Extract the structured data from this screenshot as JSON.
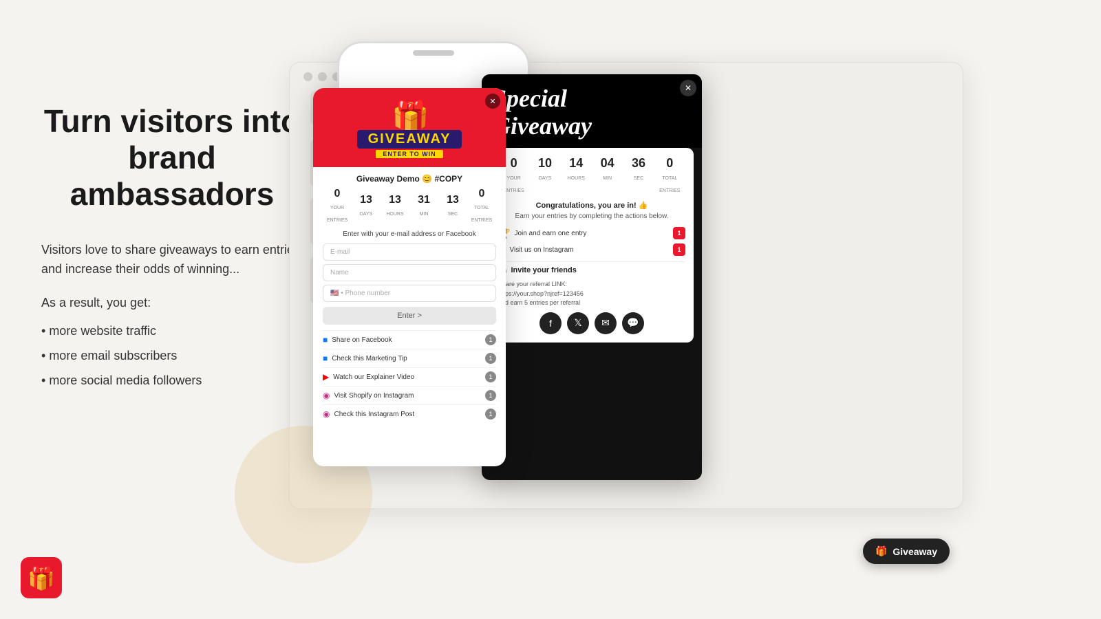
{
  "page": {
    "background_color": "#f5f3ef"
  },
  "left": {
    "heading": "Turn visitors into brand ambassadors",
    "sub_text": "Visitors love to share giveaways to earn entries and increase their odds of winning...",
    "result_heading": "As a result, you get:",
    "bullets": [
      "more website traffic",
      "more email subscribers",
      "more social media followers"
    ]
  },
  "browser": {
    "dots": [
      "#d0cec8",
      "#d0cec8",
      "#d0cec8"
    ]
  },
  "giveaway_popup": {
    "close_label": "✕",
    "banner_text": "GIVEAWAY",
    "enter_to_win": "ENTER TO WIN",
    "title": "Giveaway Demo 😊 #COPY",
    "countdown": {
      "your_entries": {
        "value": "0",
        "label": "Your entries"
      },
      "days": {
        "value": "13",
        "label": "DAYS"
      },
      "hours": {
        "value": "13",
        "label": "HOURS"
      },
      "min": {
        "value": "31",
        "label": "MIN"
      },
      "sec": {
        "value": "13",
        "label": "SEC"
      },
      "total_entries": {
        "value": "0",
        "label": "Total entries"
      }
    },
    "enter_text": "Enter with your e-mail address or Facebook",
    "email_placeholder": "E-mail",
    "name_placeholder": "Name",
    "phone_placeholder": "Phone number",
    "enter_btn": "Enter >",
    "actions": [
      {
        "icon": "facebook",
        "label": "Share on Facebook",
        "badge": "1"
      },
      {
        "icon": "facebook",
        "label": "Check this Marketing Tip",
        "badge": "1"
      },
      {
        "icon": "youtube",
        "label": "Watch our Explainer Video",
        "badge": "1"
      },
      {
        "icon": "instagram",
        "label": "Visit Shopify on Instagram",
        "badge": "1"
      },
      {
        "icon": "instagram",
        "label": "Check this Instagram Post",
        "badge": "1"
      }
    ]
  },
  "special_popup": {
    "close_label": "✕",
    "title": "Special Giveaway",
    "countdown": {
      "your_entries": {
        "value": "0",
        "label": "YOUR ENTRIES"
      },
      "days": {
        "value": "10",
        "label": "DAYS"
      },
      "hours": {
        "value": "14",
        "label": "HOURS"
      },
      "min": {
        "value": "04",
        "label": "MIN"
      },
      "sec": {
        "value": "36",
        "label": "SEC"
      },
      "total_entries": {
        "value": "0",
        "label": "TOTAL ENTRIES"
      }
    },
    "congrats_text": "Congratulations, you are in! 👍",
    "earn_text": "Earn your entries by completing the actions below.",
    "actions": [
      {
        "icon": "trophy",
        "label": "Join and earn one entry",
        "badge": "1"
      },
      {
        "icon": "instagram",
        "label": "Visit us on Instagram",
        "badge": "1"
      }
    ],
    "invite": {
      "title": "📢 Invite your friends",
      "link_text": "Share your referral LINK:\nhttps://your.shop?njref=123456\nand earn 5 entries per referral"
    },
    "social_icons": [
      "facebook",
      "twitter",
      "email",
      "messenger"
    ]
  },
  "giveaway_button": {
    "label": "Giveaway",
    "icon": "gift"
  }
}
